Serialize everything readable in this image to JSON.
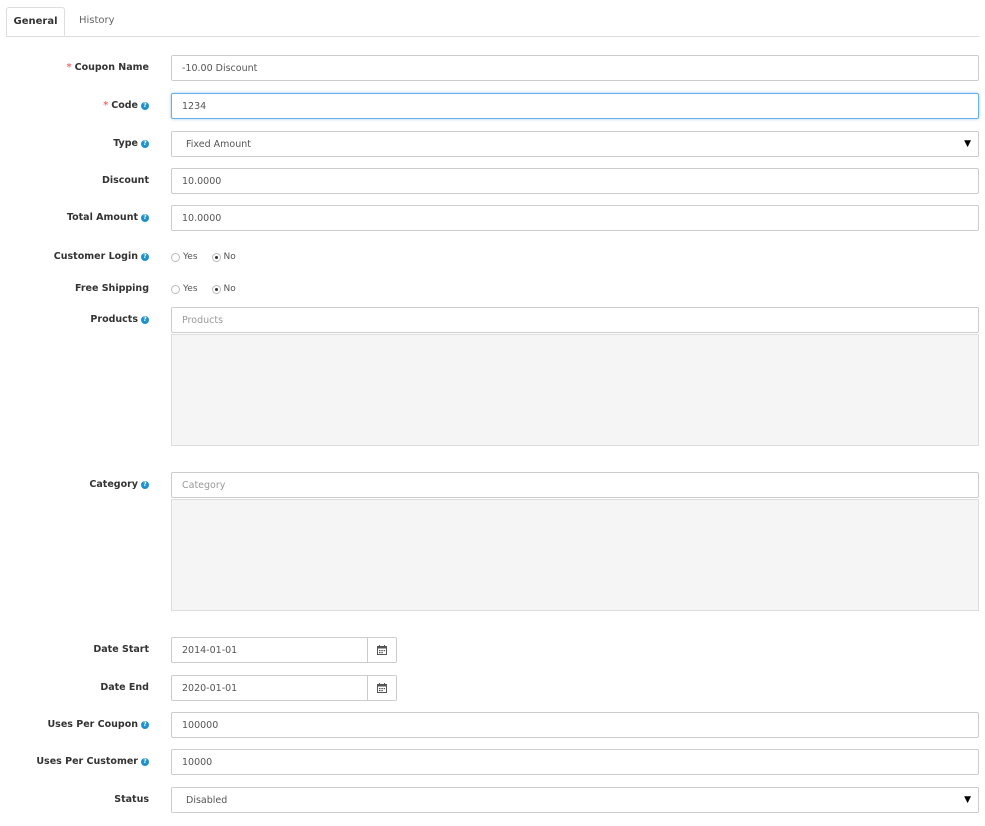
{
  "tabs": {
    "general": "General",
    "history": "History"
  },
  "fields": {
    "coupon_name": {
      "label": "Coupon Name",
      "required": "*",
      "value": "-10.00 Discount"
    },
    "code": {
      "label": "Code",
      "required": "*",
      "value": "1234"
    },
    "type": {
      "label": "Type",
      "value": "Fixed Amount"
    },
    "discount": {
      "label": "Discount",
      "value": "10.0000"
    },
    "total_amount": {
      "label": "Total Amount",
      "value": "10.0000"
    },
    "customer_login": {
      "label": "Customer Login",
      "yes": "Yes",
      "no": "No",
      "selected": "No"
    },
    "free_shipping": {
      "label": "Free Shipping",
      "yes": "Yes",
      "no": "No",
      "selected": "No"
    },
    "products": {
      "label": "Products",
      "placeholder": "Products"
    },
    "category": {
      "label": "Category",
      "placeholder": "Category"
    },
    "date_start": {
      "label": "Date Start",
      "value": "2014-01-01"
    },
    "date_end": {
      "label": "Date End",
      "value": "2020-01-01"
    },
    "uses_per_coupon": {
      "label": "Uses Per Coupon",
      "value": "100000"
    },
    "uses_per_customer": {
      "label": "Uses Per Customer",
      "value": "10000"
    },
    "status": {
      "label": "Status",
      "value": "Disabled"
    }
  },
  "icons": {
    "help": "question-circle-icon",
    "calendar": "calendar-icon",
    "dropdown": "caret-down-icon"
  },
  "colors": {
    "help_icon": "#1e91cf",
    "required_star": "#f56b6b",
    "focus_border": "#66afe9",
    "well_bg": "#f5f5f5"
  }
}
